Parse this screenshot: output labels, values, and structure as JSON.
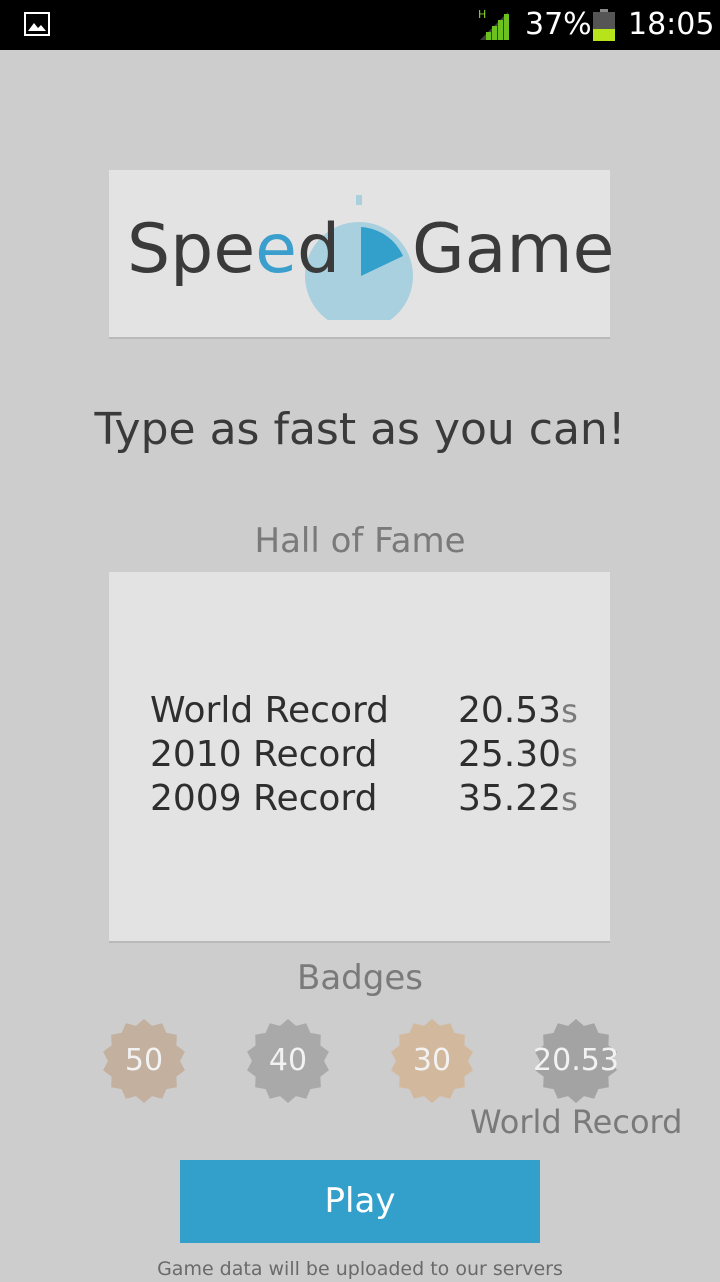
{
  "status_bar": {
    "network_type": "H",
    "battery_percent": "37%",
    "time": "18:05",
    "icons": [
      "gallery-icon",
      "signal-icon",
      "battery-icon"
    ]
  },
  "logo": {
    "word_left_start": "Spe",
    "word_left_accent": "e",
    "word_left_end": "d",
    "word_right": "Game",
    "accent_color": "#3a9fcc",
    "clock_color": "#a9d0df",
    "icon": "stopwatch-icon"
  },
  "tagline": "Type as fast as you can!",
  "hall_of_fame": {
    "title": "Hall of Fame",
    "records": [
      {
        "label": "World Record",
        "value": "20.53",
        "unit": "s"
      },
      {
        "label": "2010 Record",
        "value": "25.30",
        "unit": "s"
      },
      {
        "label": "2009 Record",
        "value": "35.22",
        "unit": "s"
      }
    ]
  },
  "badges": {
    "title": "Badges",
    "items": [
      {
        "value": "50",
        "color": "#c4b09e"
      },
      {
        "value": "40",
        "color": "#a9a9a9"
      },
      {
        "value": "30",
        "color": "#d2b89c"
      },
      {
        "value": "20.53",
        "color": "#a3a3a3",
        "caption": "World Record"
      }
    ]
  },
  "play_button": "Play",
  "footer_note": "Game data will be uploaded to our servers",
  "colors": {
    "background": "#cdcdcd",
    "card": "#e3e3e3",
    "play_button": "#33a0cc"
  }
}
